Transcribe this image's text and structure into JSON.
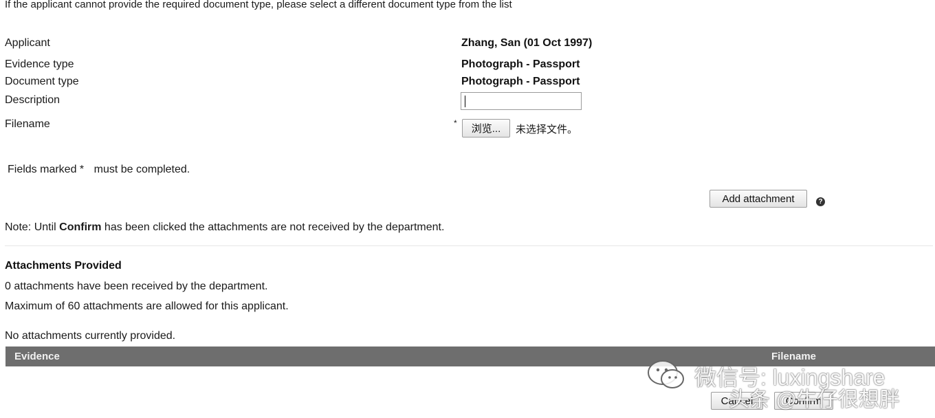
{
  "instruction": "If the applicant cannot provide the required document type, please select a different document type from the list",
  "fields": {
    "applicant_label": "Applicant",
    "applicant_value": "Zhang, San (01 Oct 1997)",
    "evidence_type_label": "Evidence type",
    "evidence_type_value": "Photograph - Passport",
    "document_type_label": "Document type",
    "document_type_value": "Photograph - Passport",
    "description_label": "Description",
    "description_value": "",
    "filename_label": "Filename",
    "filename_required_mark": "*",
    "browse_button": "浏览...",
    "no_file_text": "未选择文件。"
  },
  "required_note": {
    "prefix": "Fields marked *",
    "suffix": "must be completed."
  },
  "add_attachment_button": "Add attachment",
  "help_icon": "?",
  "confirm_note": {
    "prefix": "Note: Until ",
    "bold": "Confirm",
    "suffix": " has been clicked the attachments are not received by the department."
  },
  "attachments": {
    "heading": "Attachments Provided",
    "received_text": "0 attachments have been received by the department.",
    "maximum_text": "Maximum of 60 attachments are allowed for this applicant.",
    "empty_text": "No attachments currently provided.",
    "columns": [
      "Evidence",
      "Filename"
    ]
  },
  "footer": {
    "cancel_button": "Cancel",
    "confirm_button": "Confirm"
  },
  "watermark": {
    "wechat_text": "微信号: luxingshare",
    "toutiao_text": "头条 @牛仔很想胖",
    "icon": "wechat-icon"
  }
}
